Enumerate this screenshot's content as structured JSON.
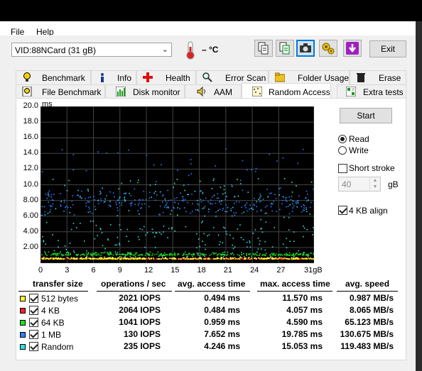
{
  "menu": {
    "file": "File",
    "help": "Help"
  },
  "toolbar": {
    "device": "VID:88NCard (31 gB)",
    "temperature": "– °C",
    "exit_label": "Exit"
  },
  "tabs_top": [
    {
      "label": "Benchmark",
      "icon": "bulb-icon"
    },
    {
      "label": "Info",
      "icon": "info-icon"
    },
    {
      "label": "Health",
      "icon": "health-cross-icon"
    },
    {
      "label": "Error Scan",
      "icon": "magnifier-icon"
    },
    {
      "label": "Folder Usage",
      "icon": "folder-icon"
    },
    {
      "label": "Erase",
      "icon": "trash-icon"
    }
  ],
  "tabs_bottom": [
    {
      "label": "File Benchmark",
      "icon": "file-bulb-icon"
    },
    {
      "label": "Disk monitor",
      "icon": "chart-icon"
    },
    {
      "label": "AAM",
      "icon": "speaker-icon"
    },
    {
      "label": "Random Access",
      "icon": "random-access-icon",
      "active": true
    },
    {
      "label": "Extra tests",
      "icon": "grid-icon"
    }
  ],
  "controls": {
    "start": "Start",
    "read": "Read",
    "write": "Write",
    "short_stroke": "Short stroke",
    "short_stroke_value": "40",
    "short_stroke_unit": "gB",
    "align": "4 KB align"
  },
  "chart_data": {
    "type": "scatter",
    "ylabel": "ms",
    "y_ticks": [
      "20.0",
      "18.0",
      "16.0",
      "14.0",
      "12.0",
      "10.0",
      "8.00",
      "6.00",
      "4.00",
      "2.00"
    ],
    "x_ticks": [
      "0",
      "3",
      "6",
      "9",
      "12",
      "15",
      "18",
      "21",
      "24",
      "27",
      "31gB"
    ],
    "xlim": [
      0,
      31
    ],
    "ylim": [
      0,
      20
    ],
    "grid": true,
    "series": [
      {
        "name": "512 bytes",
        "color": "#ffff33",
        "center": 0.49,
        "spread": 0.2
      },
      {
        "name": "4 KB",
        "color": "#ff2020",
        "center": 0.48,
        "spread": 0.15
      },
      {
        "name": "64 KB",
        "color": "#20e020",
        "center": 0.96,
        "spread": 0.35
      },
      {
        "name": "1 MB",
        "color": "#2a7fff",
        "center": 7.65,
        "spread": 1.2
      },
      {
        "name": "Random",
        "color": "#30e0e0",
        "center": 4.25,
        "spread": 2.5
      }
    ]
  },
  "table": {
    "headers": [
      "transfer size",
      "operations / sec",
      "avg. access time",
      "max. access time",
      "avg. speed"
    ],
    "rows": [
      {
        "color": "#ffff33",
        "name": "512 bytes",
        "ops": "2021 IOPS",
        "avg": "0.494 ms",
        "max": "11.570 ms",
        "speed": "0.987 MB/s"
      },
      {
        "color": "#ff2020",
        "name": "4 KB",
        "ops": "2064 IOPS",
        "avg": "0.484 ms",
        "max": "4.057 ms",
        "speed": "8.065 MB/s"
      },
      {
        "color": "#20e020",
        "name": "64 KB",
        "ops": "1041 IOPS",
        "avg": "0.959 ms",
        "max": "4.590 ms",
        "speed": "65.123 MB/s"
      },
      {
        "color": "#2a7fff",
        "name": "1 MB",
        "ops": "130 IOPS",
        "avg": "7.652 ms",
        "max": "19.785 ms",
        "speed": "130.675 MB/s"
      },
      {
        "color": "#30e0e0",
        "name": "Random",
        "ops": "235 IOPS",
        "avg": "4.246 ms",
        "max": "15.053 ms",
        "speed": "119.483 MB/s"
      }
    ]
  }
}
